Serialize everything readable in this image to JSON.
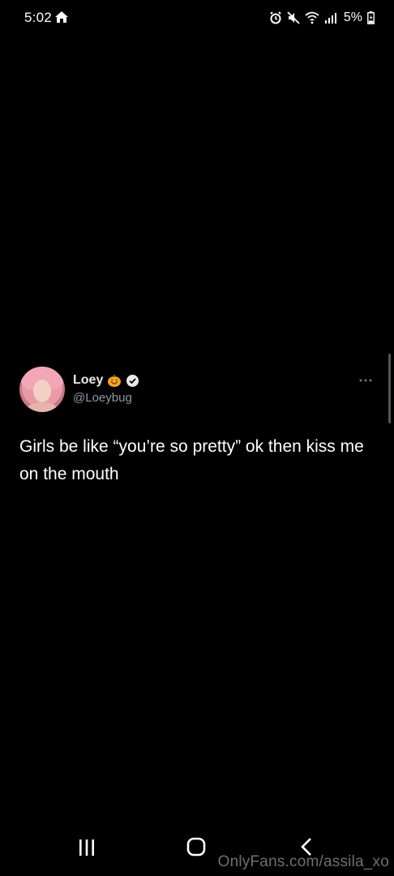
{
  "status_bar": {
    "time": "5:02",
    "battery": "5%",
    "icons": [
      "home-icon",
      "alarm-icon",
      "mute-icon",
      "wifi-icon",
      "signal-icon",
      "battery-charging-icon"
    ]
  },
  "tweet": {
    "display_name": "Loey",
    "handle": "@Loeybug",
    "text": "Girls be like “you’re so pretty” ok then kiss me on the mouth",
    "badges": [
      "pumpkin-icon",
      "verified-icon"
    ]
  },
  "nav_bar": {
    "buttons": [
      "recents-icon",
      "home-icon",
      "back-icon"
    ]
  },
  "watermark": "OnlyFans.com/assila_xo",
  "colors": {
    "background": "#000000",
    "text": "#ffffff",
    "handle": "#8b98a5",
    "pumpkin": "#f5a623"
  }
}
